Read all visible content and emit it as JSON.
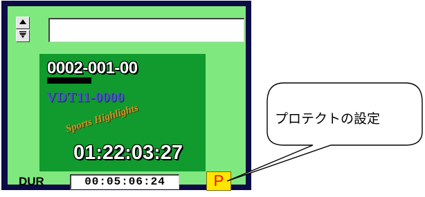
{
  "panel": {
    "title_value": "",
    "preview": {
      "clip_id": "0002-001-00",
      "clip_code": "VDT11-0000",
      "clip_subtitle": "Sports Highlights",
      "timecode": "01:22:03:27"
    },
    "duration": {
      "label": "DUR",
      "value": "00:05:06:24"
    },
    "protect_button_label": "P",
    "icons": [
      "arrow-up-icon",
      "arrow-down-icon"
    ]
  },
  "callout": {
    "text": "プロテクトの設定"
  },
  "colors": {
    "panel_frame": "#0b0b45",
    "panel_bg": "#7fe87f",
    "preview_bg": "#119a2e",
    "protect_bg": "#ffe600",
    "protect_text": "#ff0000"
  }
}
